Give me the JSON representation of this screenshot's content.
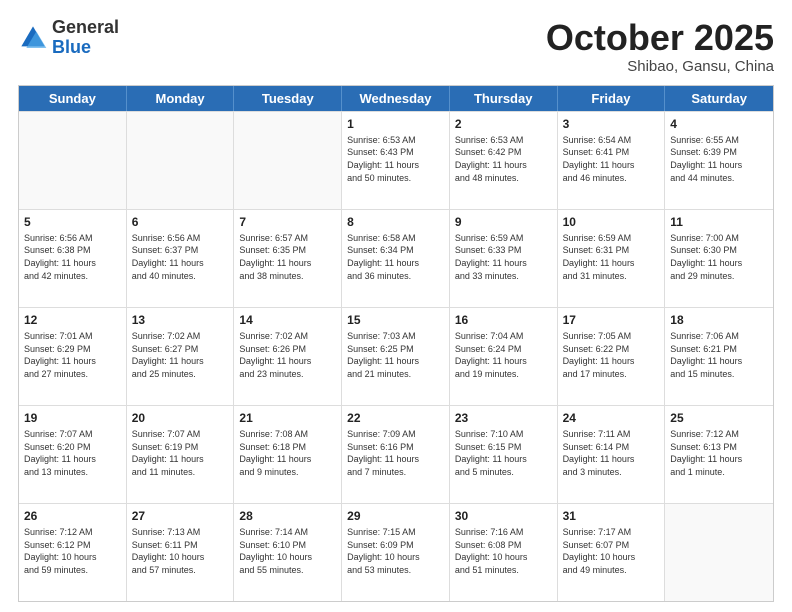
{
  "header": {
    "logo": {
      "general": "General",
      "blue": "Blue"
    },
    "title": "October 2025",
    "location": "Shibao, Gansu, China"
  },
  "weekdays": [
    "Sunday",
    "Monday",
    "Tuesday",
    "Wednesday",
    "Thursday",
    "Friday",
    "Saturday"
  ],
  "weeks": [
    [
      {
        "day": "",
        "info": ""
      },
      {
        "day": "",
        "info": ""
      },
      {
        "day": "",
        "info": ""
      },
      {
        "day": "1",
        "info": "Sunrise: 6:53 AM\nSunset: 6:43 PM\nDaylight: 11 hours\nand 50 minutes."
      },
      {
        "day": "2",
        "info": "Sunrise: 6:53 AM\nSunset: 6:42 PM\nDaylight: 11 hours\nand 48 minutes."
      },
      {
        "day": "3",
        "info": "Sunrise: 6:54 AM\nSunset: 6:41 PM\nDaylight: 11 hours\nand 46 minutes."
      },
      {
        "day": "4",
        "info": "Sunrise: 6:55 AM\nSunset: 6:39 PM\nDaylight: 11 hours\nand 44 minutes."
      }
    ],
    [
      {
        "day": "5",
        "info": "Sunrise: 6:56 AM\nSunset: 6:38 PM\nDaylight: 11 hours\nand 42 minutes."
      },
      {
        "day": "6",
        "info": "Sunrise: 6:56 AM\nSunset: 6:37 PM\nDaylight: 11 hours\nand 40 minutes."
      },
      {
        "day": "7",
        "info": "Sunrise: 6:57 AM\nSunset: 6:35 PM\nDaylight: 11 hours\nand 38 minutes."
      },
      {
        "day": "8",
        "info": "Sunrise: 6:58 AM\nSunset: 6:34 PM\nDaylight: 11 hours\nand 36 minutes."
      },
      {
        "day": "9",
        "info": "Sunrise: 6:59 AM\nSunset: 6:33 PM\nDaylight: 11 hours\nand 33 minutes."
      },
      {
        "day": "10",
        "info": "Sunrise: 6:59 AM\nSunset: 6:31 PM\nDaylight: 11 hours\nand 31 minutes."
      },
      {
        "day": "11",
        "info": "Sunrise: 7:00 AM\nSunset: 6:30 PM\nDaylight: 11 hours\nand 29 minutes."
      }
    ],
    [
      {
        "day": "12",
        "info": "Sunrise: 7:01 AM\nSunset: 6:29 PM\nDaylight: 11 hours\nand 27 minutes."
      },
      {
        "day": "13",
        "info": "Sunrise: 7:02 AM\nSunset: 6:27 PM\nDaylight: 11 hours\nand 25 minutes."
      },
      {
        "day": "14",
        "info": "Sunrise: 7:02 AM\nSunset: 6:26 PM\nDaylight: 11 hours\nand 23 minutes."
      },
      {
        "day": "15",
        "info": "Sunrise: 7:03 AM\nSunset: 6:25 PM\nDaylight: 11 hours\nand 21 minutes."
      },
      {
        "day": "16",
        "info": "Sunrise: 7:04 AM\nSunset: 6:24 PM\nDaylight: 11 hours\nand 19 minutes."
      },
      {
        "day": "17",
        "info": "Sunrise: 7:05 AM\nSunset: 6:22 PM\nDaylight: 11 hours\nand 17 minutes."
      },
      {
        "day": "18",
        "info": "Sunrise: 7:06 AM\nSunset: 6:21 PM\nDaylight: 11 hours\nand 15 minutes."
      }
    ],
    [
      {
        "day": "19",
        "info": "Sunrise: 7:07 AM\nSunset: 6:20 PM\nDaylight: 11 hours\nand 13 minutes."
      },
      {
        "day": "20",
        "info": "Sunrise: 7:07 AM\nSunset: 6:19 PM\nDaylight: 11 hours\nand 11 minutes."
      },
      {
        "day": "21",
        "info": "Sunrise: 7:08 AM\nSunset: 6:18 PM\nDaylight: 11 hours\nand 9 minutes."
      },
      {
        "day": "22",
        "info": "Sunrise: 7:09 AM\nSunset: 6:16 PM\nDaylight: 11 hours\nand 7 minutes."
      },
      {
        "day": "23",
        "info": "Sunrise: 7:10 AM\nSunset: 6:15 PM\nDaylight: 11 hours\nand 5 minutes."
      },
      {
        "day": "24",
        "info": "Sunrise: 7:11 AM\nSunset: 6:14 PM\nDaylight: 11 hours\nand 3 minutes."
      },
      {
        "day": "25",
        "info": "Sunrise: 7:12 AM\nSunset: 6:13 PM\nDaylight: 11 hours\nand 1 minute."
      }
    ],
    [
      {
        "day": "26",
        "info": "Sunrise: 7:12 AM\nSunset: 6:12 PM\nDaylight: 10 hours\nand 59 minutes."
      },
      {
        "day": "27",
        "info": "Sunrise: 7:13 AM\nSunset: 6:11 PM\nDaylight: 10 hours\nand 57 minutes."
      },
      {
        "day": "28",
        "info": "Sunrise: 7:14 AM\nSunset: 6:10 PM\nDaylight: 10 hours\nand 55 minutes."
      },
      {
        "day": "29",
        "info": "Sunrise: 7:15 AM\nSunset: 6:09 PM\nDaylight: 10 hours\nand 53 minutes."
      },
      {
        "day": "30",
        "info": "Sunrise: 7:16 AM\nSunset: 6:08 PM\nDaylight: 10 hours\nand 51 minutes."
      },
      {
        "day": "31",
        "info": "Sunrise: 7:17 AM\nSunset: 6:07 PM\nDaylight: 10 hours\nand 49 minutes."
      },
      {
        "day": "",
        "info": ""
      }
    ]
  ]
}
